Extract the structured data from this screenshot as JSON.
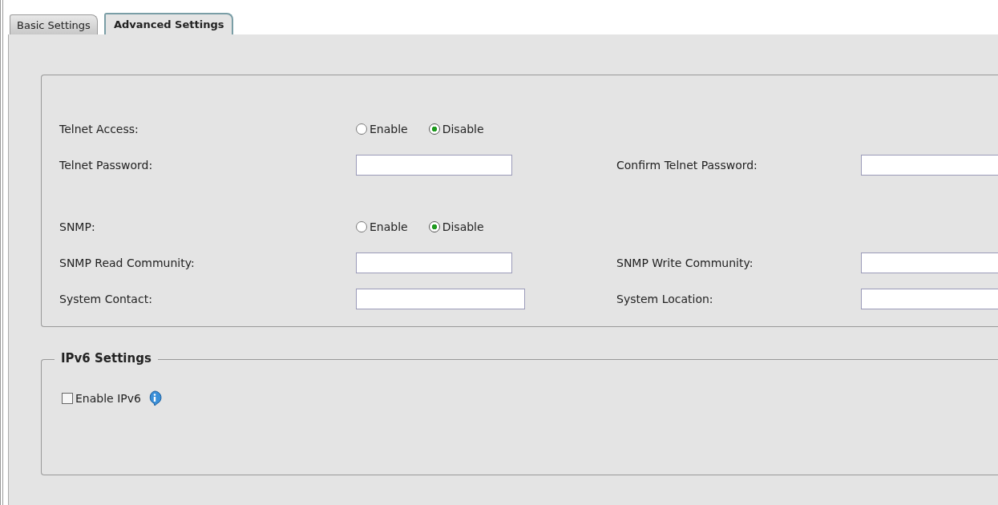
{
  "tabs": [
    {
      "label": "Basic Settings",
      "selected": false
    },
    {
      "label": "Advanced Settings",
      "selected": true
    }
  ],
  "access_settings": {
    "groups": [
      {
        "rows": [
          {
            "kind": "radio",
            "label": "Telnet Access:",
            "options": [
              {
                "label": "Enable",
                "selected": false
              },
              {
                "label": "Disable",
                "selected": true
              }
            ]
          },
          {
            "kind": "fields",
            "label": "Telnet Password:",
            "right_label": "Confirm Telnet Password:"
          }
        ]
      },
      {
        "rows": [
          {
            "kind": "radio",
            "label": "SNMP:",
            "options": [
              {
                "label": "Enable",
                "selected": false
              },
              {
                "label": "Disable",
                "selected": true
              }
            ]
          },
          {
            "kind": "fields",
            "label": "SNMP Read Community:",
            "right_label": "SNMP Write Community:"
          },
          {
            "kind": "fields",
            "label": "System Contact:",
            "right_label": "System Location:"
          }
        ]
      }
    ]
  },
  "ipv6_settings": {
    "legend": "IPv6 Settings",
    "checkbox": {
      "label": "Enable IPv6",
      "checked": false
    }
  }
}
